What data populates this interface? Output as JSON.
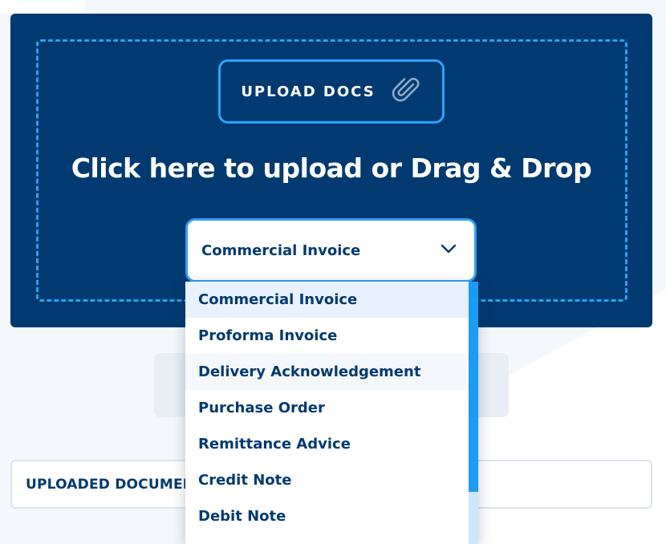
{
  "upload": {
    "button_label": "UPLOAD DOCS",
    "button_icon": "paperclip-icon",
    "headline": "Click here to upload or Drag & Drop"
  },
  "doc_type_select": {
    "value": "Commercial Invoice",
    "icon": "chevron-down-icon",
    "options": [
      "Commercial Invoice",
      "Proforma Invoice",
      "Delivery Acknowledgement",
      "Purchase Order",
      "Remittance Advice",
      "Credit Note",
      "Debit Note"
    ],
    "selected_index": 0,
    "hovered_index": 2
  },
  "uploaded_panel": {
    "title": "UPLOADED DOCUMENTS"
  },
  "colors": {
    "navy": "#003a70",
    "accent_blue": "#2ea0f7",
    "background": "#f4f7fb"
  }
}
